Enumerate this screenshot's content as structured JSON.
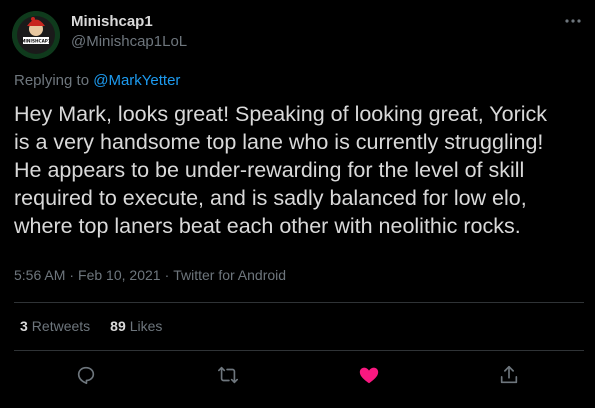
{
  "author": {
    "display_name": "Minishcap1",
    "handle": "@Minishcap1LoL",
    "avatar_text": "MINISHCAP1"
  },
  "reply": {
    "prefix": "Replying to ",
    "mention": "@MarkYetter"
  },
  "text_lines": [
    "Hey Mark, looks great! Speaking of looking great, Yorick",
    "is a very handsome top lane who is currently struggling!",
    "He appears to be under-rewarding for the level of skill",
    "required to execute, and is sadly balanced for low elo,",
    "where top laners beat each other with neolithic rocks."
  ],
  "meta": {
    "time": "5:56 AM",
    "separator": "·",
    "date": "Feb 10, 2021",
    "source": "Twitter for Android"
  },
  "stats": {
    "retweets_count": "3",
    "retweets_label": "Retweets",
    "likes_count": "89",
    "likes_label": "Likes"
  },
  "actions": {
    "icons": [
      "reply-icon",
      "retweet-icon",
      "heart-icon",
      "share-icon"
    ],
    "like_color": "#f91880",
    "icon_color": "#6e767d"
  },
  "colors": {
    "background": "#000000",
    "text": "#d9d9d9",
    "muted": "#6e767d",
    "link": "#1d9bf0"
  }
}
